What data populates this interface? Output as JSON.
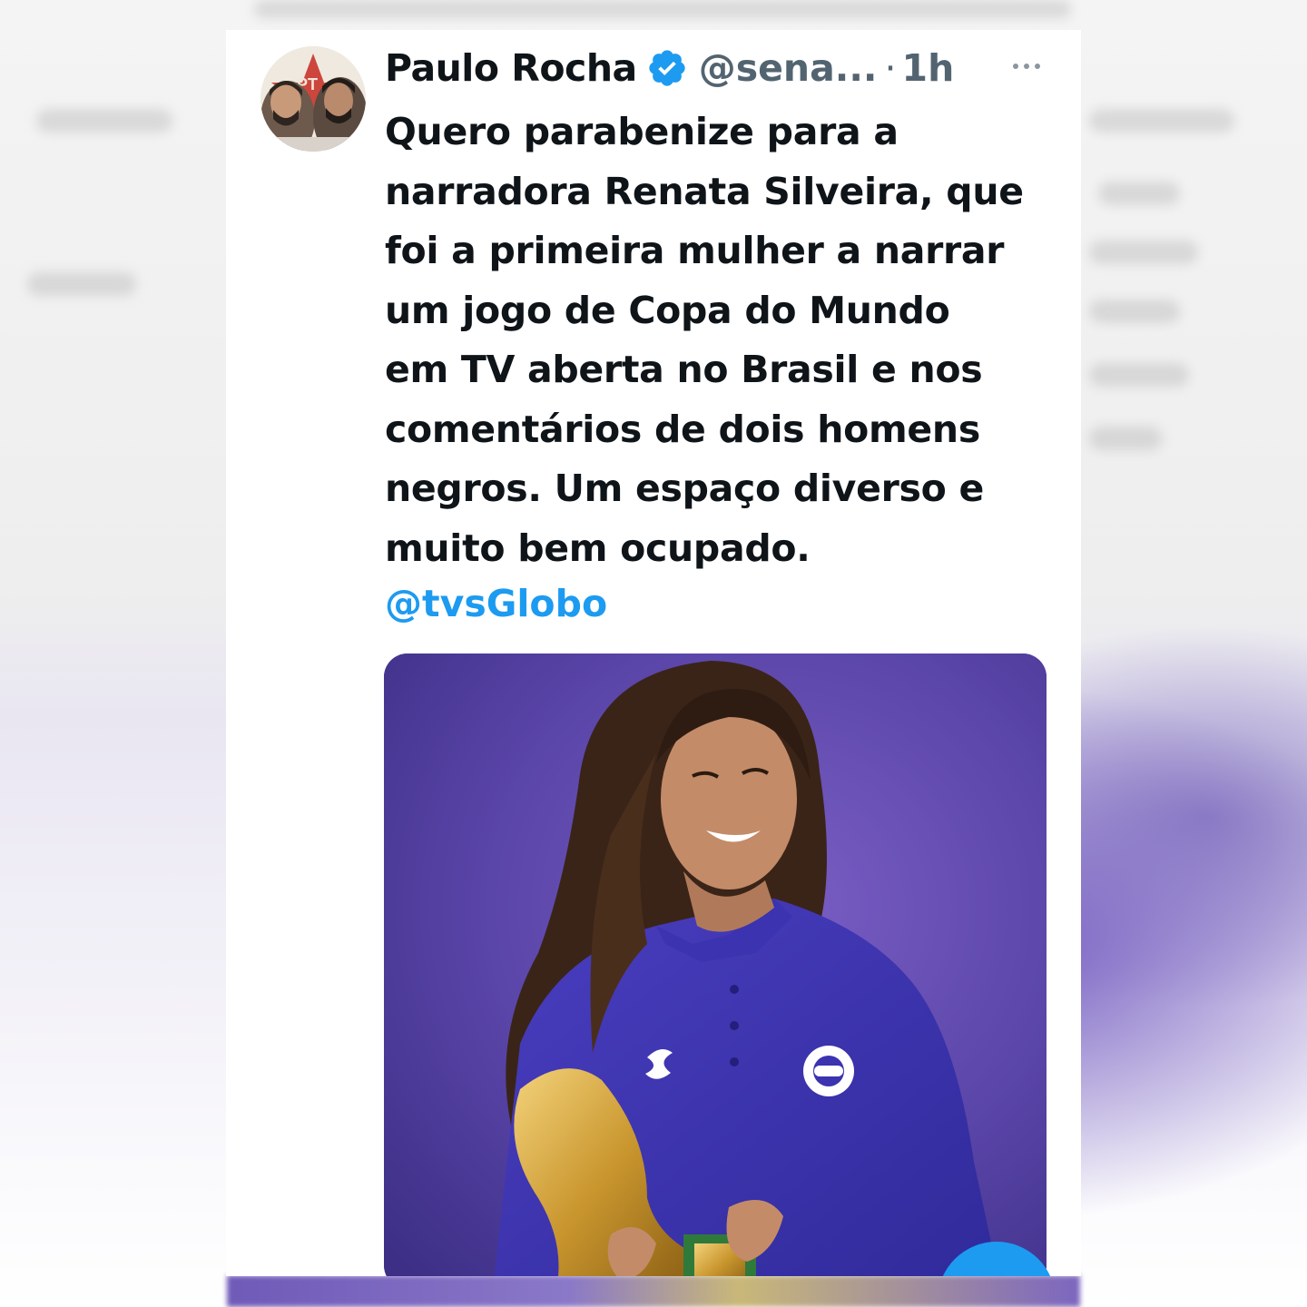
{
  "tweet": {
    "author_name": "Paulo Rocha",
    "handle": "@sena...",
    "separator": "·",
    "time": "1h",
    "text_lines": [
      "Quero parabenize para a",
      "narradora Renata Silveira, que",
      "foi a primeira mulher a narrar",
      "um jogo de Copa do Mundo",
      "em TV aberta no Brasil e nos",
      "comentários de dois homens",
      "negros. Um espaço diverso e",
      "muito bem ocupado."
    ],
    "mention": "@tvsGlobo",
    "icons": {
      "verified": "verified-badge-icon",
      "more": "more-options-icon",
      "compose": "compose-button"
    }
  },
  "colors": {
    "accent": "#1d9bf0",
    "text_primary": "#0f1419",
    "text_secondary": "#536471",
    "media_background": "#5b47a8"
  }
}
